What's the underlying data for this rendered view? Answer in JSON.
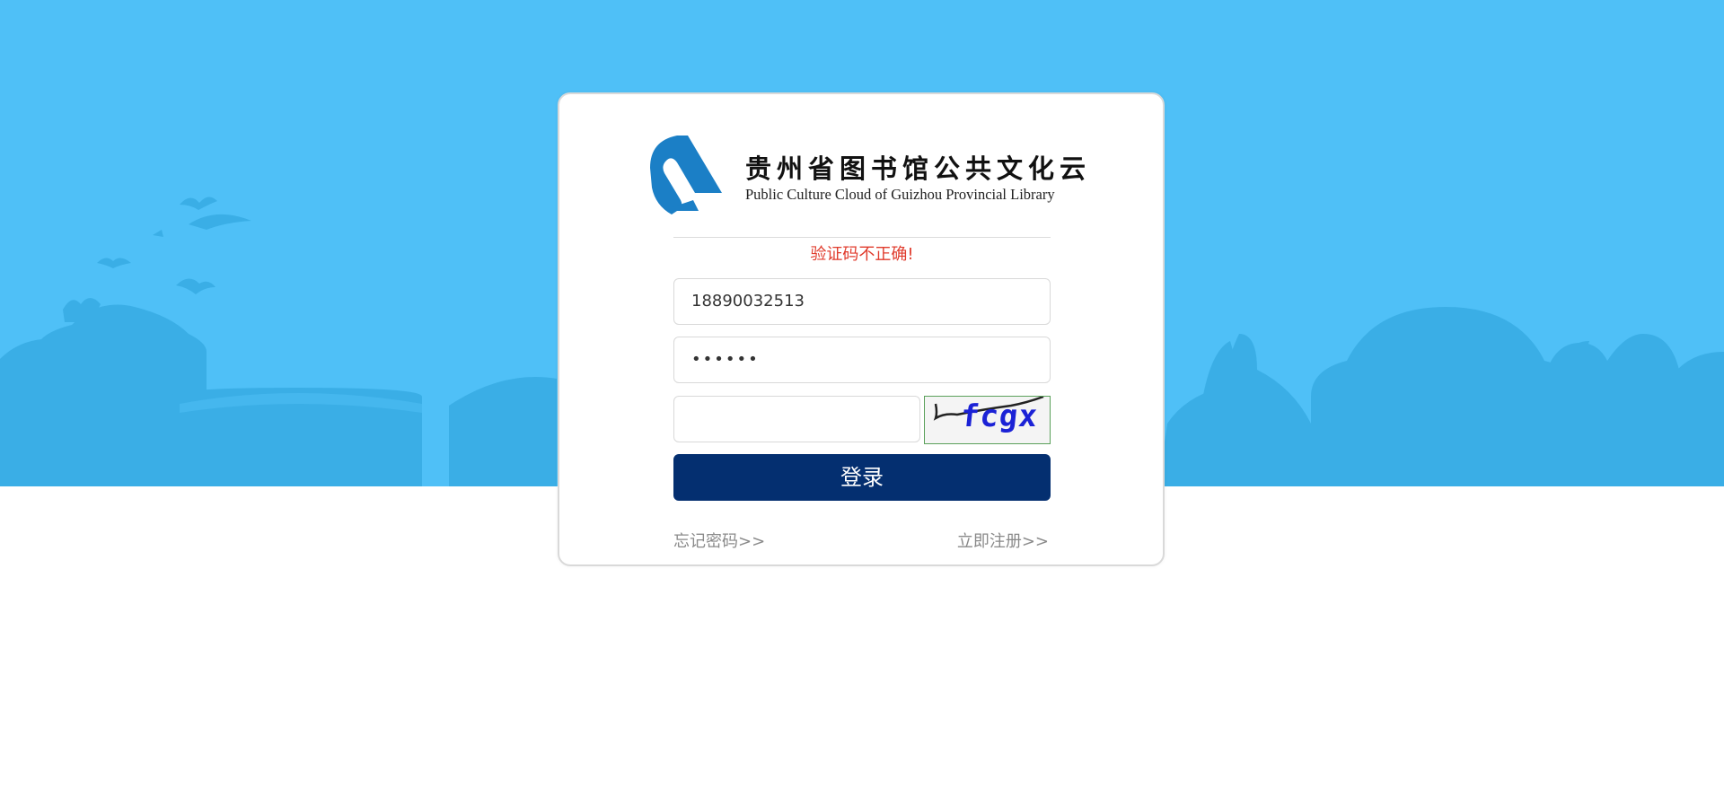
{
  "banner": {
    "background_color": "#4fc0f7",
    "silhouette_color": "#3aaee6"
  },
  "logo": {
    "mark_color": "#1b7fc6",
    "title_cn": "贵州省图书馆公共文化云",
    "title_en": "Public Culture Cloud of Guizhou Provincial Library"
  },
  "form": {
    "error_message": "验证码不正确!",
    "phone_value": "18890032513",
    "password_masked": "••••••",
    "captcha_value": "",
    "captcha_image_text": "fcgx",
    "login_label": "登录"
  },
  "links": {
    "forgot_password": "忘记密码>>",
    "register": "立即注册>>"
  },
  "colors": {
    "error": "#e03b2c",
    "button": "#042f70",
    "link": "#8a8a8a"
  }
}
